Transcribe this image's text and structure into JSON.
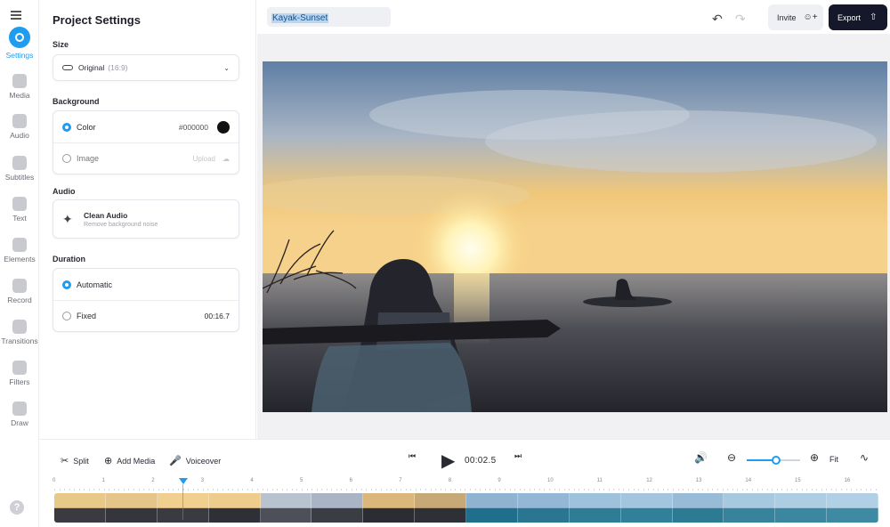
{
  "project": {
    "name": "Kayak-Sunset"
  },
  "rail": {
    "items": [
      {
        "label": "Settings",
        "icon": "settings-icon",
        "active": true
      },
      {
        "label": "Media",
        "icon": "plus-icon"
      },
      {
        "label": "Audio",
        "icon": "music-note-icon"
      },
      {
        "label": "Subtitles",
        "icon": "subtitles-icon"
      },
      {
        "label": "Text",
        "icon": "text-icon"
      },
      {
        "label": "Elements",
        "icon": "elements-icon"
      },
      {
        "label": "Record",
        "icon": "record-icon"
      },
      {
        "label": "Transitions",
        "icon": "transitions-icon"
      },
      {
        "label": "Filters",
        "icon": "filters-icon"
      },
      {
        "label": "Draw",
        "icon": "pencil-icon"
      }
    ],
    "help": "?"
  },
  "panel": {
    "title": "Project Settings",
    "size": {
      "section": "Size",
      "value": "Original",
      "ratio": "(16:9)"
    },
    "background": {
      "section": "Background",
      "color_label": "Color",
      "color_value": "#000000",
      "image_label": "Image",
      "image_action": "Upload"
    },
    "audio": {
      "section": "Audio",
      "clean_title": "Clean Audio",
      "clean_sub": "Remove background noise"
    },
    "duration": {
      "section": "Duration",
      "auto_label": "Automatic",
      "fixed_label": "Fixed",
      "fixed_value": "00:16.7"
    }
  },
  "header": {
    "invite_label": "Invite",
    "export_label": "Export"
  },
  "toolbar": {
    "split": "Split",
    "add_media": "Add Media",
    "voiceover": "Voiceover",
    "time": "00:02.5",
    "fit": "Fit",
    "zoom_level": 0.55
  },
  "timeline": {
    "ruler_labels": [
      "0",
      "1",
      "2",
      "3",
      "4",
      "5",
      "6",
      "7",
      "8",
      "9",
      "10",
      "11",
      "12",
      "13",
      "14",
      "15",
      "16"
    ],
    "playhead_seconds": 2.6,
    "thumbnail_count": 16
  },
  "colors": {
    "accent": "#1f9bf0",
    "export_bg": "#14182a"
  }
}
